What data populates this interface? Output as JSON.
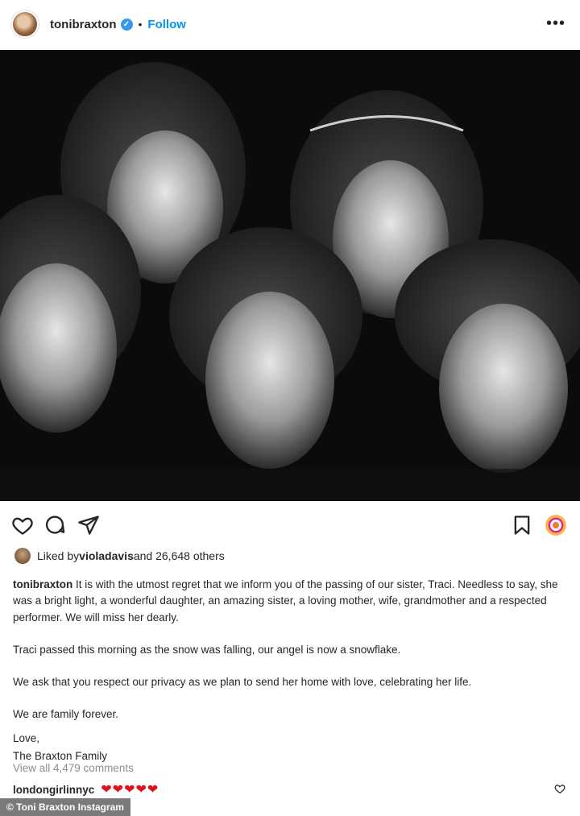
{
  "header": {
    "username": "tonibraxton",
    "separator": "•",
    "follow_label": "Follow",
    "verified_glyph": "✓",
    "more_glyph": "•••"
  },
  "post": {
    "image_alt_icon": "photo"
  },
  "likes": {
    "prefix": "Liked by ",
    "user": "violadavis",
    "suffix": " and 26,648 others"
  },
  "caption": {
    "author": "tonibraxton",
    "para1": " It is with the utmost regret that we inform you of the passing of our sister, Traci. Needless to say, she was a bright light, a wonderful daughter, an amazing sister, a loving mother, wife, grandmother and a respected performer. We will miss her dearly.",
    "para2": "Traci passed this morning as the snow was falling, our angel is now a snowflake.",
    "para3": "We ask that you respect our privacy as we plan to send her home with love, celebrating her life.",
    "para4": "We are family forever.",
    "love": "Love,",
    "family": "The Braxton Family"
  },
  "comments": {
    "view_all": "View all 4,479 comments",
    "top_user": "londongirlinnyc",
    "top_text": "❤❤❤❤❤"
  },
  "credit": "© Toni Braxton Instagram",
  "colors": {
    "link_blue": "#0095f6",
    "verified_blue": "#3897f0",
    "heart_red": "#e0101c"
  }
}
